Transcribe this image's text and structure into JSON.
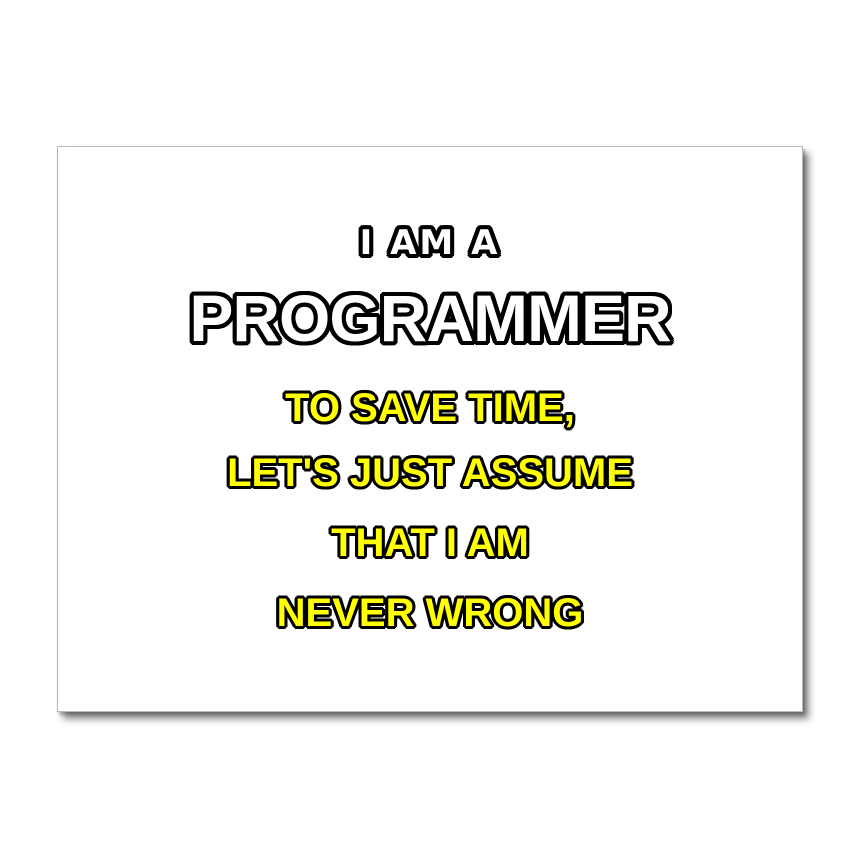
{
  "card": {
    "lines": [
      "I AM A",
      "PROGRAMMER",
      "TO SAVE TIME,",
      "LET'S JUST ASSUME",
      "THAT I AM",
      "NEVER WRONG"
    ]
  },
  "colors": {
    "background": "#ffffff",
    "headline_fill": "#ffffff",
    "body_fill": "#ffff00",
    "outline": "#000000"
  }
}
